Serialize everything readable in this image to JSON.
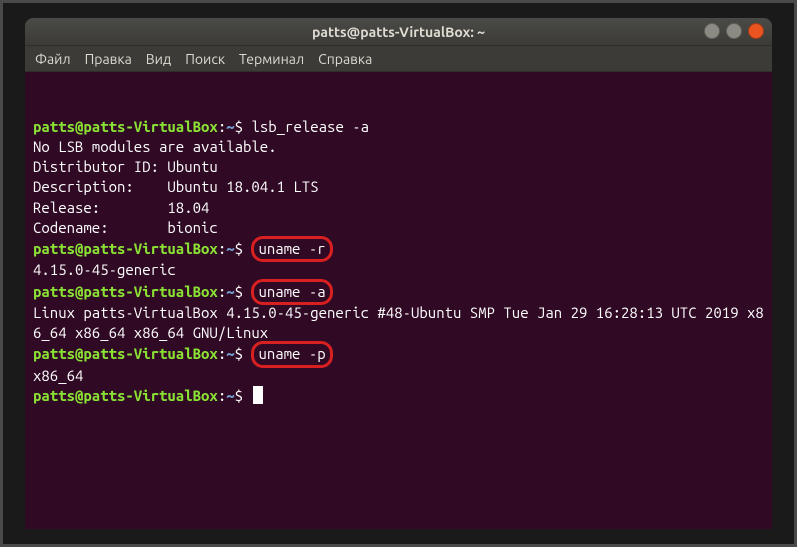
{
  "window": {
    "title": "patts@patts-VirtualBox: ~"
  },
  "menubar": {
    "items": [
      "Файл",
      "Правка",
      "Вид",
      "Поиск",
      "Терминал",
      "Справка"
    ]
  },
  "prompt": {
    "user_host": "patts@patts-VirtualBox",
    "separator": ":",
    "path": "~",
    "dollar": "$"
  },
  "terminal": {
    "lines": [
      {
        "type": "prompt",
        "cmd": "lsb_release -a",
        "highlight": false
      },
      {
        "type": "output",
        "text": "No LSB modules are available."
      },
      {
        "type": "output",
        "text": "Distributor ID: Ubuntu"
      },
      {
        "type": "output",
        "text": "Description:    Ubuntu 18.04.1 LTS"
      },
      {
        "type": "output",
        "text": "Release:        18.04"
      },
      {
        "type": "output",
        "text": "Codename:       bionic"
      },
      {
        "type": "prompt",
        "cmd": "uname -r",
        "highlight": true
      },
      {
        "type": "output",
        "text": "4.15.0-45-generic"
      },
      {
        "type": "prompt",
        "cmd": "uname -a",
        "highlight": true
      },
      {
        "type": "output",
        "text": "Linux patts-VirtualBox 4.15.0-45-generic #48-Ubuntu SMP Tue Jan 29 16:28:13 UTC 2019 x86_64 x86_64 x86_64 GNU/Linux"
      },
      {
        "type": "prompt",
        "cmd": "uname -p",
        "highlight": true
      },
      {
        "type": "output",
        "text": "x86_64"
      },
      {
        "type": "prompt",
        "cmd": "",
        "highlight": false,
        "cursor": true
      }
    ]
  }
}
